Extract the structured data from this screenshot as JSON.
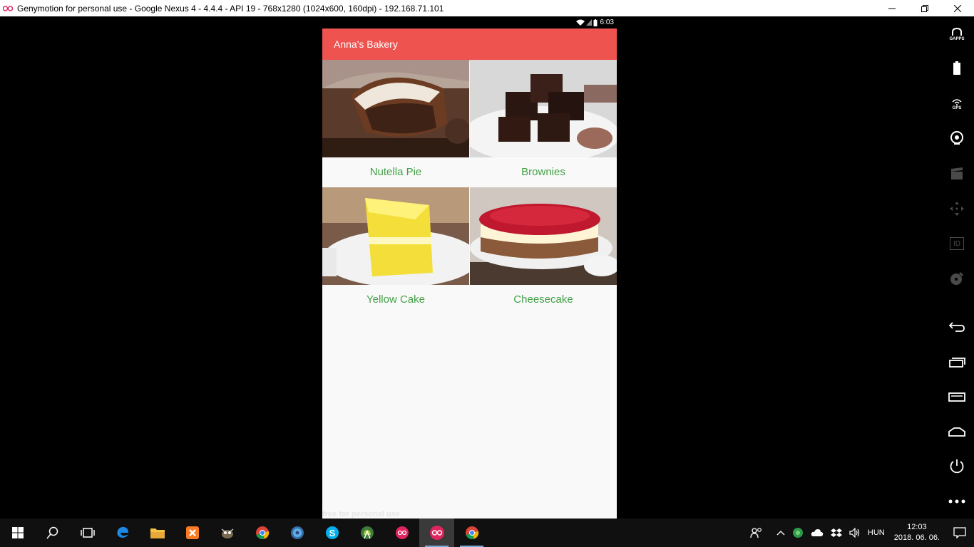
{
  "window": {
    "title": "Genymotion for personal use - Google Nexus 4 - 4.4.4 - API 19 - 768x1280 (1024x600, 160dpi) - 192.168.71.101",
    "minimize_icon": "minimize-icon",
    "maximize_icon": "restore-icon",
    "close_icon": "close-icon"
  },
  "device": {
    "status_time": "6:03",
    "app_title": "Anna's Bakery",
    "accent_color": "#ef5350",
    "label_color": "#43a047",
    "items": [
      {
        "label": "Nutella Pie"
      },
      {
        "label": "Brownies"
      },
      {
        "label": "Yellow Cake"
      },
      {
        "label": "Cheesecake"
      }
    ],
    "watermark": "free for personal use"
  },
  "sidebar": {
    "gapps_caption": "GAPPS",
    "gps_caption": "GPS",
    "id_caption": "ID"
  },
  "taskbar": {
    "language": "HUN",
    "time": "12:03",
    "date": "2018. 06. 06."
  }
}
